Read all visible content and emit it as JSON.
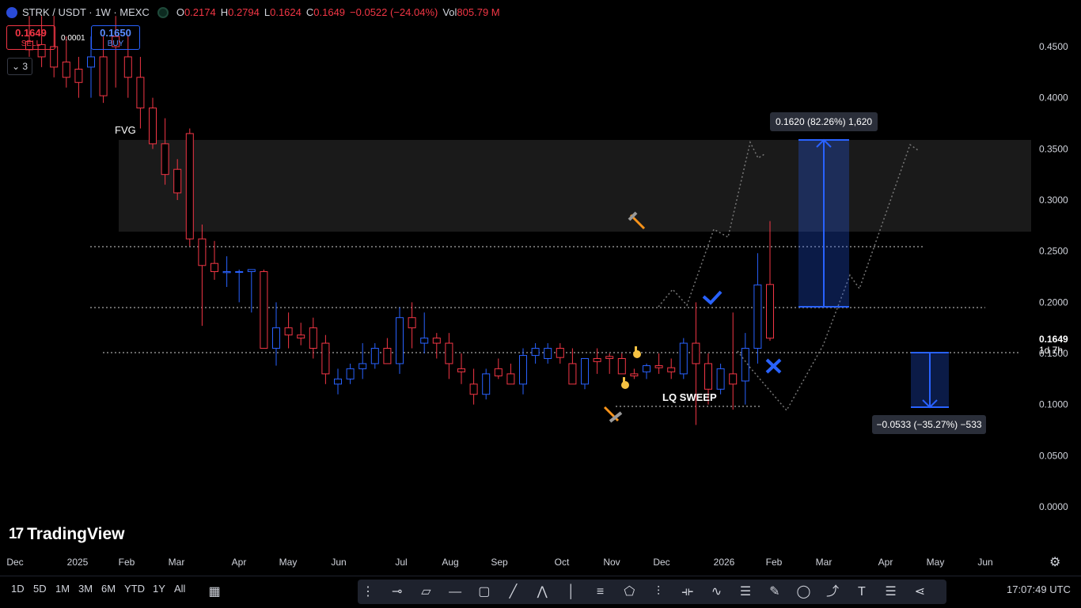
{
  "header": {
    "symbol": "STRK / USDT · 1W · MEXC",
    "open_label": "O",
    "open": "0.2174",
    "high_label": "H",
    "high": "0.2794",
    "low_label": "L",
    "low": "0.1624",
    "close_label": "C",
    "close": "0.1649",
    "change": "−0.0522 (−24.04%)",
    "vol_label": "Vol",
    "vol": "805.79 M"
  },
  "trade": {
    "sell_price": "0.1649",
    "sell_label": "SELL",
    "buy_price": "0.1650",
    "buy_label": "BUY",
    "spread": "0.0001",
    "indicators_count": "3"
  },
  "price_axis": {
    "ticks": [
      "0.4500",
      "0.4000",
      "0.3500",
      "0.3000",
      "0.2500",
      "0.2000",
      "0.1500",
      "0.1000",
      "0.0500",
      "0.0000"
    ],
    "current_price": "0.1649",
    "countdown": "1d 7h"
  },
  "time_axis": [
    "Dec",
    "2025",
    "Feb",
    "Mar",
    "Apr",
    "May",
    "Jun",
    "Jul",
    "Aug",
    "Sep",
    "Oct",
    "Nov",
    "Dec",
    "2026",
    "Feb",
    "Mar",
    "Apr",
    "May",
    "Jun"
  ],
  "annotations": {
    "fvg": "FVG",
    "lq_sweep": "LQ SWEEP",
    "long_measure": "0.1620 (82.26%) 1,620",
    "short_measure": "−0.0533 (−35.27%) −533"
  },
  "colors": {
    "up": "#2962ff",
    "down": "#f23645",
    "accent": "#2962ff",
    "bg": "#000000"
  },
  "chart_data": {
    "type": "candlestick",
    "timeframe": "1W",
    "ylim": [
      0,
      0.48
    ],
    "candles": [
      {
        "o": 0.455,
        "h": 0.48,
        "l": 0.44,
        "c": 0.447
      },
      {
        "o": 0.452,
        "h": 0.48,
        "l": 0.43,
        "c": 0.44
      },
      {
        "o": 0.45,
        "h": 0.48,
        "l": 0.42,
        "c": 0.43
      },
      {
        "o": 0.435,
        "h": 0.46,
        "l": 0.41,
        "c": 0.42
      },
      {
        "o": 0.428,
        "h": 0.44,
        "l": 0.4,
        "c": 0.415
      },
      {
        "o": 0.43,
        "h": 0.46,
        "l": 0.4,
        "c": 0.44
      },
      {
        "o": 0.44,
        "h": 0.46,
        "l": 0.395,
        "c": 0.402
      },
      {
        "o": 0.46,
        "h": 0.48,
        "l": 0.41,
        "c": 0.45
      },
      {
        "o": 0.44,
        "h": 0.46,
        "l": 0.4,
        "c": 0.42
      },
      {
        "o": 0.42,
        "h": 0.44,
        "l": 0.37,
        "c": 0.39
      },
      {
        "o": 0.39,
        "h": 0.4,
        "l": 0.35,
        "c": 0.355
      },
      {
        "o": 0.355,
        "h": 0.38,
        "l": 0.315,
        "c": 0.325
      },
      {
        "o": 0.33,
        "h": 0.34,
        "l": 0.3,
        "c": 0.307
      },
      {
        "o": 0.365,
        "h": 0.37,
        "l": 0.255,
        "c": 0.262
      },
      {
        "o": 0.262,
        "h": 0.276,
        "l": 0.177,
        "c": 0.236
      },
      {
        "o": 0.238,
        "h": 0.26,
        "l": 0.222,
        "c": 0.23
      },
      {
        "o": 0.229,
        "h": 0.245,
        "l": 0.215,
        "c": 0.23
      },
      {
        "o": 0.23,
        "h": 0.232,
        "l": 0.2,
        "c": 0.23
      },
      {
        "o": 0.23,
        "h": 0.23,
        "l": 0.19,
        "c": 0.232
      },
      {
        "o": 0.23,
        "h": 0.232,
        "l": 0.155,
        "c": 0.155
      },
      {
        "o": 0.155,
        "h": 0.2,
        "l": 0.138,
        "c": 0.175
      },
      {
        "o": 0.175,
        "h": 0.19,
        "l": 0.155,
        "c": 0.168
      },
      {
        "o": 0.168,
        "h": 0.18,
        "l": 0.158,
        "c": 0.165
      },
      {
        "o": 0.175,
        "h": 0.185,
        "l": 0.145,
        "c": 0.155
      },
      {
        "o": 0.16,
        "h": 0.168,
        "l": 0.12,
        "c": 0.13
      },
      {
        "o": 0.12,
        "h": 0.135,
        "l": 0.11,
        "c": 0.125
      },
      {
        "o": 0.125,
        "h": 0.14,
        "l": 0.12,
        "c": 0.135
      },
      {
        "o": 0.135,
        "h": 0.16,
        "l": 0.125,
        "c": 0.14
      },
      {
        "o": 0.14,
        "h": 0.16,
        "l": 0.135,
        "c": 0.155
      },
      {
        "o": 0.155,
        "h": 0.165,
        "l": 0.14,
        "c": 0.14
      },
      {
        "o": 0.14,
        "h": 0.195,
        "l": 0.13,
        "c": 0.185
      },
      {
        "o": 0.185,
        "h": 0.2,
        "l": 0.155,
        "c": 0.175
      },
      {
        "o": 0.16,
        "h": 0.19,
        "l": 0.15,
        "c": 0.165
      },
      {
        "o": 0.165,
        "h": 0.17,
        "l": 0.145,
        "c": 0.16
      },
      {
        "o": 0.16,
        "h": 0.17,
        "l": 0.125,
        "c": 0.14
      },
      {
        "o": 0.135,
        "h": 0.15,
        "l": 0.12,
        "c": 0.132
      },
      {
        "o": 0.12,
        "h": 0.135,
        "l": 0.1,
        "c": 0.11
      },
      {
        "o": 0.11,
        "h": 0.135,
        "l": 0.105,
        "c": 0.13
      },
      {
        "o": 0.135,
        "h": 0.145,
        "l": 0.125,
        "c": 0.128
      },
      {
        "o": 0.13,
        "h": 0.14,
        "l": 0.12,
        "c": 0.12
      },
      {
        "o": 0.12,
        "h": 0.155,
        "l": 0.11,
        "c": 0.148
      },
      {
        "o": 0.148,
        "h": 0.16,
        "l": 0.14,
        "c": 0.155
      },
      {
        "o": 0.145,
        "h": 0.16,
        "l": 0.14,
        "c": 0.155
      },
      {
        "o": 0.155,
        "h": 0.16,
        "l": 0.14,
        "c": 0.146
      },
      {
        "o": 0.14,
        "h": 0.155,
        "l": 0.12,
        "c": 0.12
      },
      {
        "o": 0.12,
        "h": 0.145,
        "l": 0.115,
        "c": 0.145
      },
      {
        "o": 0.145,
        "h": 0.155,
        "l": 0.13,
        "c": 0.142
      },
      {
        "o": 0.147,
        "h": 0.15,
        "l": 0.13,
        "c": 0.145
      },
      {
        "o": 0.145,
        "h": 0.15,
        "l": 0.13,
        "c": 0.13
      },
      {
        "o": 0.13,
        "h": 0.135,
        "l": 0.125,
        "c": 0.128
      },
      {
        "o": 0.132,
        "h": 0.14,
        "l": 0.125,
        "c": 0.138
      },
      {
        "o": 0.138,
        "h": 0.15,
        "l": 0.13,
        "c": 0.136
      },
      {
        "o": 0.136,
        "h": 0.145,
        "l": 0.125,
        "c": 0.132
      },
      {
        "o": 0.13,
        "h": 0.165,
        "l": 0.125,
        "c": 0.16
      },
      {
        "o": 0.16,
        "h": 0.2,
        "l": 0.08,
        "c": 0.14
      },
      {
        "o": 0.14,
        "h": 0.15,
        "l": 0.1,
        "c": 0.115
      },
      {
        "o": 0.115,
        "h": 0.14,
        "l": 0.11,
        "c": 0.135
      },
      {
        "o": 0.13,
        "h": 0.19,
        "l": 0.095,
        "c": 0.12
      },
      {
        "o": 0.123,
        "h": 0.17,
        "l": 0.1,
        "c": 0.155
      },
      {
        "o": 0.155,
        "h": 0.248,
        "l": 0.14,
        "c": 0.217
      },
      {
        "o": 0.2174,
        "h": 0.2794,
        "l": 0.1624,
        "c": 0.1649
      }
    ],
    "levels": [
      0.2555,
      0.196,
      0.1518,
      0.102
    ],
    "fvg_zone": [
      0.269,
      0.359
    ],
    "long_position": {
      "entry": 0.196,
      "target": 0.359
    },
    "short_position": {
      "entry": 0.1518,
      "target": 0.102
    }
  }
}
